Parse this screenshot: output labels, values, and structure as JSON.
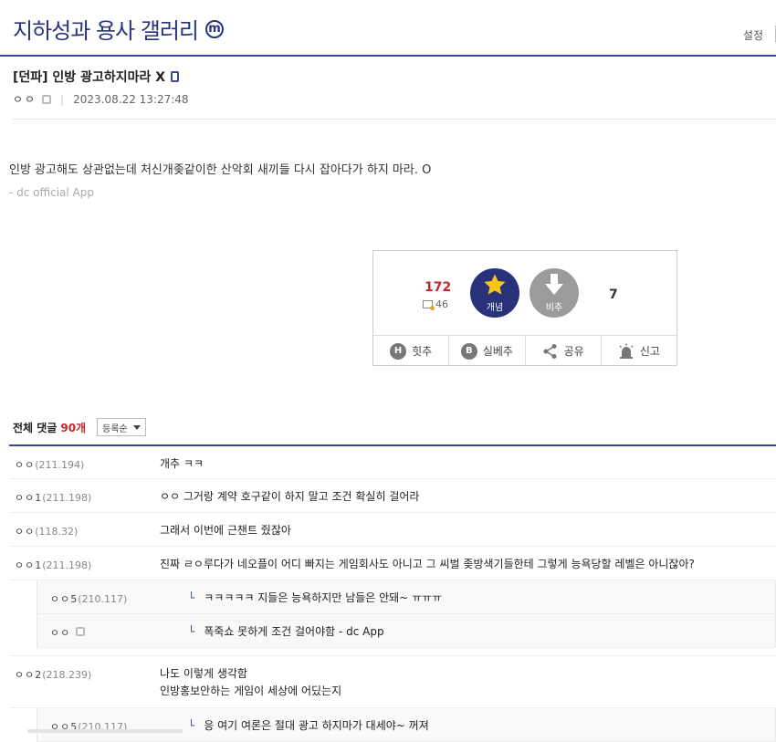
{
  "header": {
    "gallery_title": "지하성과 용사 갤러리",
    "minor_badge": "m",
    "settings_label": "설정"
  },
  "post": {
    "title": "[던파] 인방 광고하지마라 X",
    "writer": "ㅇㅇ",
    "date": "2023.08.22 13:27:48",
    "body": "인방 광고해도 상관없는데 처신개좆같이한 산악회 새끼들 다시 잡아다가 하지 마라. O",
    "app_sign": "- dc official App"
  },
  "recommend": {
    "up_count": "172",
    "fixed_up": "46",
    "upvote_label": "개념",
    "downvote_label": "비추",
    "down_count": "7",
    "actions": [
      {
        "icon": "H",
        "label": "힛추"
      },
      {
        "icon": "B",
        "label": "실베추"
      },
      {
        "icon": "share-icon",
        "label": "공유"
      },
      {
        "icon": "report-icon",
        "label": "신고"
      }
    ]
  },
  "comments_header": {
    "label": "전체 댓글",
    "count": "90개",
    "sort": "등록순"
  },
  "comments": [
    {
      "nick": "ㅇㅇ",
      "ip": "(211.194)",
      "text": "개추 ㅋㅋ"
    },
    {
      "nick": "ㅇㅇ1",
      "ip": "(211.198)",
      "text": "ㅇㅇ 그거랑 계약 호구같이 하지 말고 조건 확실히 걸어라"
    },
    {
      "nick": "ㅇㅇ",
      "ip": "(118.32)",
      "text": "그래서 이번에 근챈트 줬잖아"
    },
    {
      "nick": "ㅇㅇ1",
      "ip": "(211.198)",
      "text": "진짜 ㄹㅇ루다가 네오플이 어디 빠지는 게임회사도 아니고 그 씨벌 좆방색기들한테 그렇게 능욕당할 레벨은 아니잖아?"
    },
    {
      "nick": "ㅇㅇ5",
      "ip": "(210.117)",
      "text": "ㅋㅋㅋㅋㅋ 지들은 능욕하지만 남들은 안돼~ ㅠㅠㅠ",
      "reply": true
    },
    {
      "nick": "ㅇㅇ",
      "ip": "",
      "text": "폭죽쇼 못하게 조건 걸어야함 - dc App",
      "reply": true,
      "fixed": true
    },
    {
      "nick": "ㅇㅇ2",
      "ip": "(218.239)",
      "text": "나도 이렇게 생각함",
      "text2": "인방홍보안하는 게임이 세상에 어딨는지"
    },
    {
      "nick": "ㅇㅇ5",
      "ip": "(210.117)",
      "text": "응 여기 여론은 절대 광고 하지마가 대세야~ 꺼져",
      "reply": true
    }
  ]
}
